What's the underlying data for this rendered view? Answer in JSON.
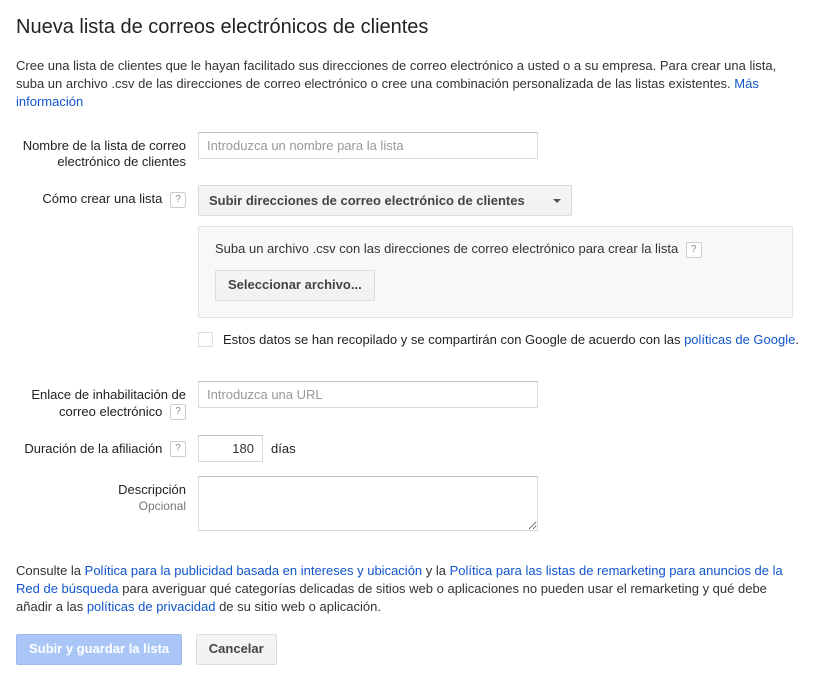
{
  "title": "Nueva lista de correos electrónicos de clientes",
  "intro": {
    "text1": "Cree una lista de clientes que le hayan facilitado sus direcciones de correo electrónico a usted o a su empresa. Para crear una lista, suba un archivo .csv de las direcciones de correo electrónico o cree una combinación personalizada de las listas existentes. ",
    "more_info": "Más información"
  },
  "fields": {
    "list_name": {
      "label": "Nombre de la lista de correo electrónico de clientes",
      "placeholder": "Introduzca un nombre para la lista"
    },
    "how_create": {
      "label": "Cómo crear una lista",
      "dropdown": "Subir direcciones de correo electrónico de clientes"
    },
    "upload": {
      "hint": "Suba un archivo .csv con las direcciones de correo electrónico para crear la lista",
      "button": "Seleccionar archivo..."
    },
    "consent": {
      "text": "Estos datos se han recopilado y se compartirán con Google de acuerdo con las ",
      "link": "políticas de Google",
      "period": "."
    },
    "optout": {
      "label": "Enlace de inhabilitación de correo electrónico",
      "placeholder": "Introduzca una URL"
    },
    "duration": {
      "label": "Duración de la afiliación",
      "value": "180",
      "unit": "días"
    },
    "description": {
      "label": "Descripción",
      "sublabel": "Opcional"
    }
  },
  "footer": {
    "t1": "Consulte la ",
    "l1": "Política para la publicidad basada en intereses y ubicación",
    "t2": " y la ",
    "l2": "Política para las listas de remarketing para anuncios de la Red de búsqueda",
    "t3": " para averiguar qué categorías delicadas de sitios web o aplicaciones no pueden usar el remarketing y qué debe añadir a las ",
    "l3": "políticas de privacidad",
    "t4": " de su sitio web o aplicación."
  },
  "actions": {
    "submit": "Subir y guardar la lista",
    "cancel": "Cancelar"
  },
  "help_glyph": "?"
}
